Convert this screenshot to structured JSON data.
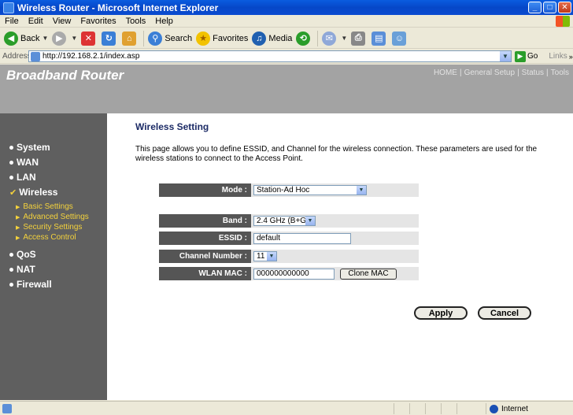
{
  "window": {
    "title": "Wireless Router - Microsoft Internet Explorer"
  },
  "menu": [
    "File",
    "Edit",
    "View",
    "Favorites",
    "Tools",
    "Help"
  ],
  "toolbar": {
    "back": "Back",
    "search": "Search",
    "favorites": "Favorites",
    "media": "Media"
  },
  "address": {
    "label": "Address",
    "url": "http://192.168.2.1/index.asp",
    "go": "Go",
    "links": "Links"
  },
  "header": {
    "brand": "Broadband Router",
    "nav": [
      "HOME",
      "General Setup",
      "Status",
      "Tools"
    ]
  },
  "sidebar": {
    "items": [
      "System",
      "WAN",
      "LAN",
      "Wireless",
      "QoS",
      "NAT",
      "Firewall"
    ],
    "subitems": [
      "Basic Settings",
      "Advanced Settings",
      "Security Settings",
      "Access Control"
    ]
  },
  "content": {
    "title": "Wireless Setting",
    "description": "This page allows you to define ESSID, and Channel for the wireless connection. These parameters are used for the wireless stations to connect to the Access Point."
  },
  "form": {
    "mode": {
      "label": "Mode :",
      "value": "Station-Ad Hoc"
    },
    "band": {
      "label": "Band :",
      "value": "2.4 GHz (B+G)"
    },
    "essid": {
      "label": "ESSID :",
      "value": "default"
    },
    "channel": {
      "label": "Channel Number :",
      "value": "11"
    },
    "mac": {
      "label": "WLAN MAC :",
      "value": "000000000000",
      "clone": "Clone MAC"
    }
  },
  "actions": {
    "apply": "Apply",
    "cancel": "Cancel"
  },
  "status": {
    "zone": "Internet"
  }
}
